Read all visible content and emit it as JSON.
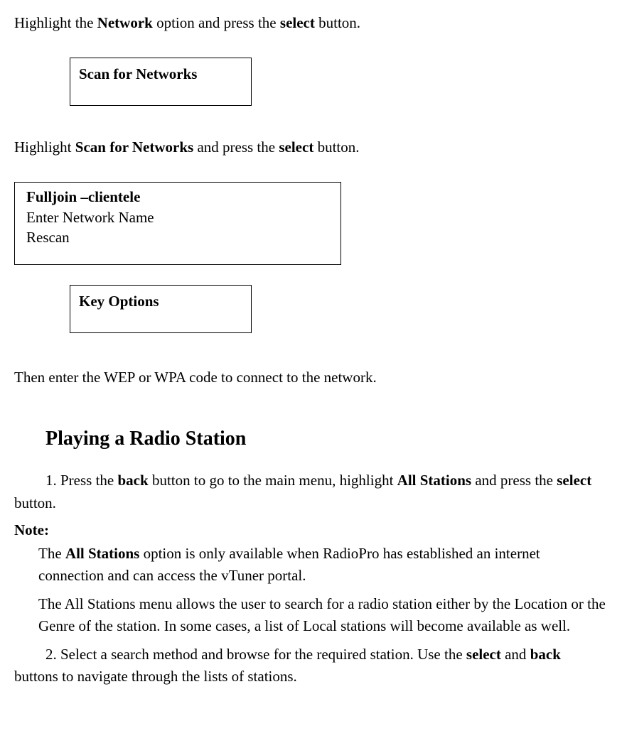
{
  "intro": {
    "p1_pre": "Highlight the ",
    "p1_bold1": "Network",
    "p1_mid": " option and press the ",
    "p1_bold2": "select",
    "p1_post": " button."
  },
  "box1": {
    "label": "Scan for Networks"
  },
  "p2": {
    "pre": "Highlight ",
    "bold1": "Scan for Networks",
    "mid": " and press the ",
    "bold2": "select",
    "post": " button."
  },
  "box2": {
    "line1": "Fulljoin –clientele",
    "line2": "Enter Network Name",
    "line3": "Rescan"
  },
  "box3": {
    "label": "Key Options"
  },
  "p3": "Then enter the WEP or WPA code to connect to the network.",
  "section": {
    "title": "Playing a Radio Station"
  },
  "step1": {
    "pre": "1. Press the ",
    "bold1": "back",
    "mid1": " button to go to the main menu, highlight ",
    "bold2": "All Stations",
    "mid2": " and press the ",
    "bold3": "select",
    "post": " button."
  },
  "note": {
    "label": "Note:",
    "body1_pre": "The ",
    "body1_bold": "All Stations",
    "body1_post": " option is only available when RadioPro has established an internet connection and can access the vTuner portal.",
    "body2": "The All Stations menu allows the user to search for a radio station either by the Location or the Genre of the station. In some cases, a list of Local stations will become available as well."
  },
  "step2": {
    "pre": "2. Select a search method and browse for the required station. Use the ",
    "bold1": "select",
    "mid": " and ",
    "bold2": "back",
    "post": " buttons to navigate through the lists of stations."
  }
}
